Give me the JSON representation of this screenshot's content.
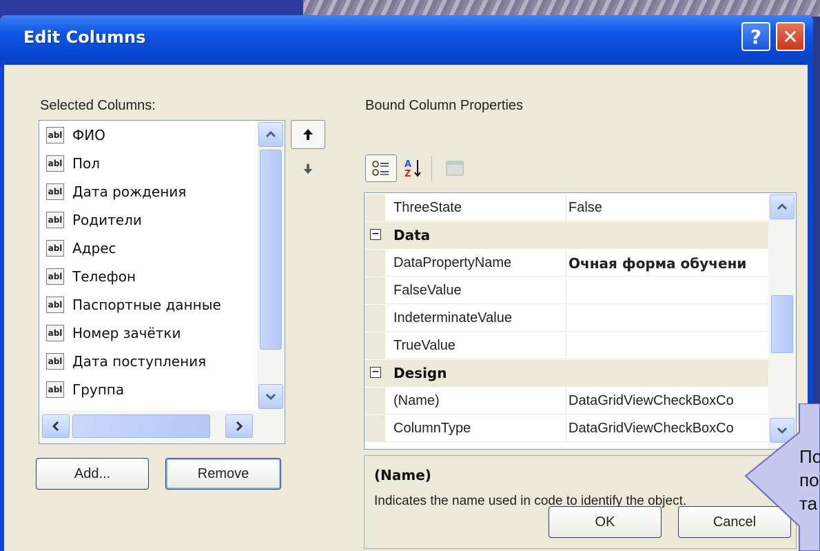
{
  "dialog": {
    "title": "Edit Columns",
    "help_glyph": "?",
    "close_glyph": "✕"
  },
  "selected_columns": {
    "label": "Selected Columns:",
    "items": [
      {
        "icon": "abl",
        "label": "ФИО"
      },
      {
        "icon": "abl",
        "label": "Пол"
      },
      {
        "icon": "abl",
        "label": "Дата рождения"
      },
      {
        "icon": "abl",
        "label": "Родители"
      },
      {
        "icon": "abl",
        "label": "Адрес"
      },
      {
        "icon": "abl",
        "label": "Телефон"
      },
      {
        "icon": "abl",
        "label": "Паспортные данные"
      },
      {
        "icon": "abl",
        "label": "Номер зачётки"
      },
      {
        "icon": "abl",
        "label": "Дата поступления"
      },
      {
        "icon": "abl",
        "label": "Группа"
      }
    ],
    "add_label": "Add...",
    "remove_label": "Remove"
  },
  "properties": {
    "label": "Bound Column Properties",
    "rows": [
      {
        "kind": "prop",
        "name": "ThreeState",
        "value": "False",
        "bold": false
      },
      {
        "kind": "cat",
        "name": "Data"
      },
      {
        "kind": "prop",
        "name": "DataPropertyName",
        "value": "Очная форма обучени",
        "bold": true
      },
      {
        "kind": "prop",
        "name": "FalseValue",
        "value": "",
        "bold": false
      },
      {
        "kind": "prop",
        "name": "IndeterminateValue",
        "value": "",
        "bold": false
      },
      {
        "kind": "prop",
        "name": "TrueValue",
        "value": "",
        "bold": false
      },
      {
        "kind": "cat",
        "name": "Design"
      },
      {
        "kind": "prop",
        "name": "(Name)",
        "value": "DataGridViewCheckBoxCo",
        "bold": false
      },
      {
        "kind": "prop",
        "name": "ColumnType",
        "value": "DataGridViewCheckBoxCo",
        "bold": false
      }
    ],
    "description_title": "(Name)",
    "description_text": "Indicates the name used in code to identify the object."
  },
  "footer": {
    "ok_label": "OK",
    "cancel_label": "Cancel"
  },
  "callout": {
    "lines": [
      "По",
      "по",
      "та"
    ]
  }
}
